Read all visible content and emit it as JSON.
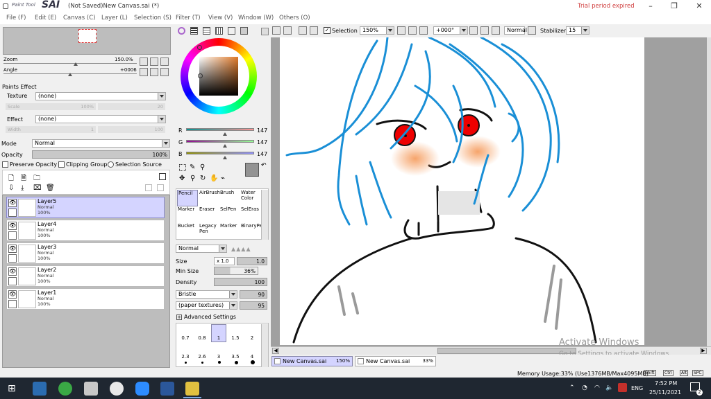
{
  "app": {
    "logo_small": "Paint Tool",
    "logo_big": "SAI",
    "title": "(Not Saved)New Canvas.sai (*)",
    "trial": "Trial period expired"
  },
  "menu": [
    "File (F)",
    "Edit (E)",
    "Canvas (C)",
    "Layer (L)",
    "Selection (S)",
    "Filter (T)",
    "View (V)",
    "Window (W)",
    "Others (O)"
  ],
  "navigator": {
    "zoom_label": "Zoom",
    "zoom_value": "150.0%",
    "angle_label": "Angle",
    "angle_value": "+0006"
  },
  "paints_effect": {
    "header": "Paints Effect",
    "texture_label": "Texture",
    "texture_value": "(none)",
    "scale_label": "Scale",
    "scale_value": "100%",
    "scale_num": "20",
    "effect_label": "Effect",
    "effect_value": "(none)",
    "width_label": "Width",
    "width_value": "1",
    "width_num": "100"
  },
  "layer_panel": {
    "mode_label": "Mode",
    "mode_value": "Normal",
    "opacity_label": "Opacity",
    "opacity_value": "100%",
    "preserve": "Preserve Opacity",
    "clipping": "Clipping Group",
    "selection_source": "Selection Source"
  },
  "layers": [
    {
      "name": "Layer5",
      "mode": "Normal",
      "opacity": "100%"
    },
    {
      "name": "Layer4",
      "mode": "Normal",
      "opacity": "100%"
    },
    {
      "name": "Layer3",
      "mode": "Normal",
      "opacity": "100%"
    },
    {
      "name": "Layer2",
      "mode": "Normal",
      "opacity": "100%"
    },
    {
      "name": "Layer1",
      "mode": "Normal",
      "opacity": "100%"
    }
  ],
  "color": {
    "r_label": "R",
    "r": "147",
    "g_label": "G",
    "g": "147",
    "b_label": "B",
    "b": "147",
    "current": "#939393"
  },
  "tools": [
    {
      "l1": "Pencil",
      "l2": ""
    },
    {
      "l1": "AirBrush",
      "l2": ""
    },
    {
      "l1": "Brush",
      "l2": ""
    },
    {
      "l1": "Water",
      "l2": "Color"
    },
    {
      "l1": "Marker",
      "l2": ""
    },
    {
      "l1": "Eraser",
      "l2": ""
    },
    {
      "l1": "SelPen",
      "l2": ""
    },
    {
      "l1": "SelEras",
      "l2": ""
    },
    {
      "l1": "Bucket",
      "l2": ""
    },
    {
      "l1": "Legacy",
      "l2": "Pen"
    },
    {
      "l1": "Marker",
      "l2": ""
    },
    {
      "l1": "BinaryPe",
      "l2": ""
    }
  ],
  "brush": {
    "mode": "Normal",
    "size_label": "Size",
    "size_mult": "x 1.0",
    "size_value": "1.0",
    "minsize_label": "Min Size",
    "minsize_value": "36%",
    "density_label": "Density",
    "density_value": "100",
    "shape": "Bristle",
    "shape_value": "90",
    "texture": "(paper textures)",
    "texture_value": "95",
    "advanced": "Advanced Settings"
  },
  "brush_sizes": [
    [
      "0.7",
      "0.8",
      "1",
      "1.5",
      "2"
    ],
    [
      "2.3",
      "2.6",
      "3",
      "3.5",
      "4"
    ]
  ],
  "toolbar": {
    "selection": "Selection",
    "zoom": "150%",
    "angle": "+000°",
    "blend": "Normal",
    "stabilizer_label": "Stabilizer",
    "stabilizer_value": "15"
  },
  "tabs": [
    {
      "name": "New Canvas.sai",
      "zoom": "150%"
    },
    {
      "name": "New Canvas.sai",
      "zoom": "33%"
    }
  ],
  "status": {
    "memory": "Memory Usage:33% (Use1376MB/Max4095MB)",
    "keys": [
      "Shift",
      "Ctrl",
      "Alt",
      "SPC"
    ]
  },
  "watermark": {
    "title": "Activate Windows",
    "sub": "Go to Settings to activate Windows."
  },
  "taskbar": {
    "lang": "ENG",
    "time": "7:52 PM",
    "date": "25/11/2021",
    "notif": "2"
  }
}
